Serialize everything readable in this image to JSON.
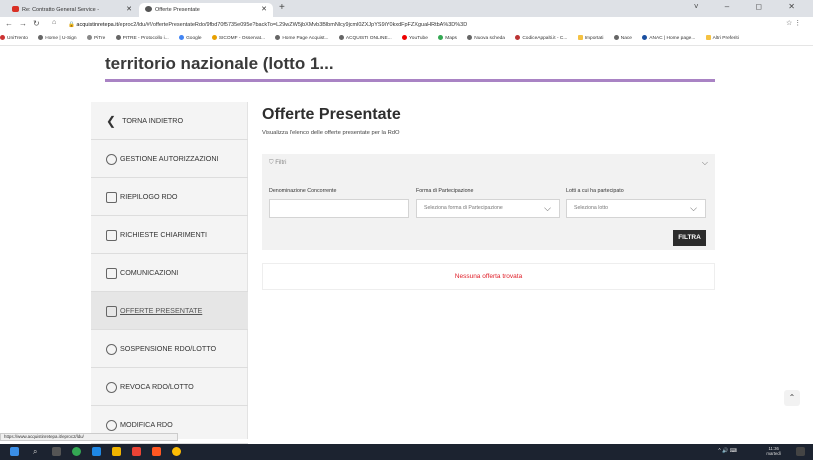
{
  "browser": {
    "tabs": [
      {
        "label": "Re: Contratto General Service - ",
        "icon": "gmail-icon"
      },
      {
        "label": "Offerte Presentate",
        "icon": "site-icon"
      }
    ],
    "new_tab": "+",
    "window_controls": "˅ – ◻ ✕",
    "url_host": "acquistinretepa.it",
    "url_path": "/eproc2/ldu/#!/offertePresentateRdo/9fbd70f5735e095e?backTo=L29wZW5jbXMvb3BlbmNlcy9jcml0ZXJpYS9iY0kxdFpFZXguaHRtbA%3D%3D",
    "bookmarks": [
      "UniTrento",
      "Home | U-Sign",
      "PiTre",
      "PITRE - Protocollo i...",
      "Google",
      "SICOMF - Osservat...",
      "Home Page Acquist...",
      "ACQUISTI ONLINE...",
      "YouTube",
      "Maps",
      "Nuova scheda",
      "CodiceAppalti.it - C...",
      "Importati",
      "Nace",
      "ANAC | Home page...",
      "Altri Preferiti"
    ]
  },
  "page": {
    "heading": "territorio nazionale (lotto 1...",
    "sidebar": [
      {
        "label": "TORNA INDIETRO",
        "icon": "chevron-left-icon"
      },
      {
        "label": "GESTIONE AUTORIZZAZIONI",
        "icon": "users-key-icon"
      },
      {
        "label": "RIEPILOGO RDO",
        "icon": "list-icon"
      },
      {
        "label": "RICHIESTE CHIARIMENTI",
        "icon": "question-doc-icon"
      },
      {
        "label": "COMUNICAZIONI",
        "icon": "messages-icon"
      },
      {
        "label": "OFFERTE PRESENTATE",
        "icon": "offer-icon"
      },
      {
        "label": "SOSPENSIONE RDO/LOTTO",
        "icon": "pause-icon"
      },
      {
        "label": "REVOCA RDO/LOTTO",
        "icon": "revoke-icon"
      },
      {
        "label": "MODIFICA RDO",
        "icon": "edit-icon"
      }
    ],
    "title": "Offerte Presentate",
    "subtitle": "Visualizza l'elenco delle offerte presentate per la RdO",
    "filters": {
      "header": "Filtri",
      "field1_label": "Denominazione Concorrente",
      "field1_value": "",
      "field2_label": "Forma di Partecipazione",
      "field2_placeholder": "Seleziona forma di Partecipazione",
      "field3_label": "Lotti a cui ha partecipato",
      "field3_placeholder": "Seleziona lotto",
      "button": "FILTRA"
    },
    "empty_message": "Nessuna offerta trovata"
  },
  "status_url": "https://www.acquistinretepa.it/eproc2/ldu/",
  "clock": {
    "time": "11:36",
    "day": "martedì"
  },
  "colors": {
    "accent": "#a983c4",
    "error": "#e0202a",
    "button": "#2c2c2c"
  }
}
